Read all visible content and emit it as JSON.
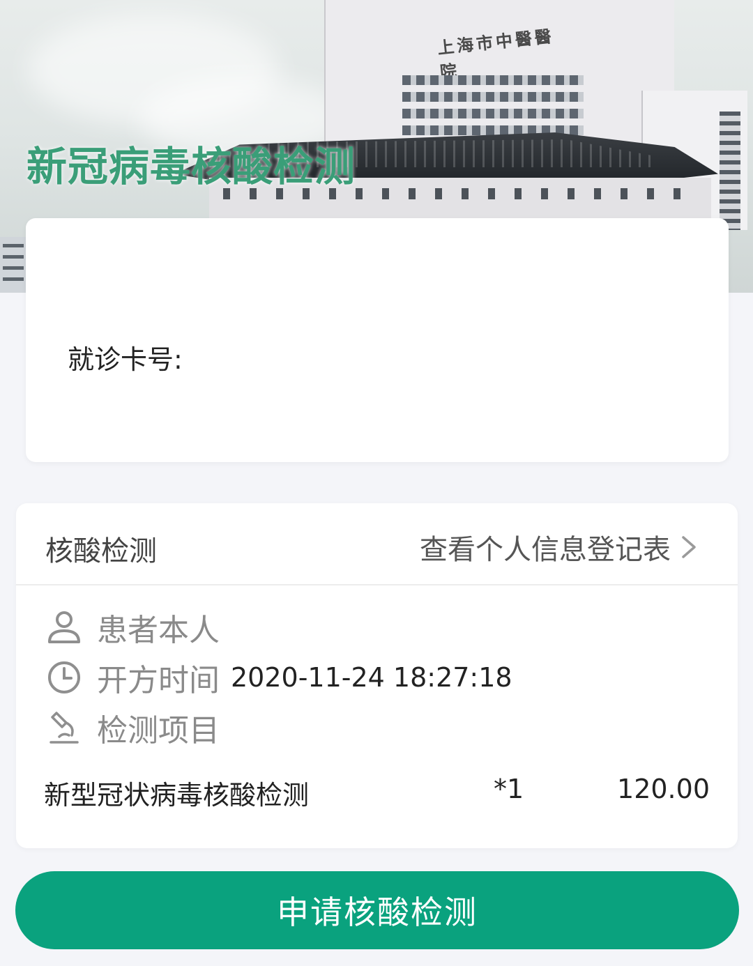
{
  "banner": {
    "title": "新冠病毒核酸检测",
    "signboard": "上海市中醫醫院"
  },
  "card_info": {
    "card_number_label": "就诊卡号:"
  },
  "order": {
    "section_title": "核酸检测",
    "view_form_link": "查看个人信息登记表",
    "patient_label": "患者本人",
    "prescribe_time_label": "开方时间",
    "prescribe_time_value": "2020-11-24 18:27:18",
    "test_items_label": "检测项目",
    "items": [
      {
        "name": "新型冠状病毒核酸检测",
        "qty": "*1",
        "price": "120.00"
      }
    ]
  },
  "actions": {
    "apply_label": "申请核酸检测"
  },
  "colors": {
    "accent": "#0aa27e",
    "title_green": "#3a9e78"
  },
  "icons": {
    "patient": "person-icon",
    "time": "clock-icon",
    "test": "microscope-icon",
    "chevron": "chevron-right-icon"
  }
}
